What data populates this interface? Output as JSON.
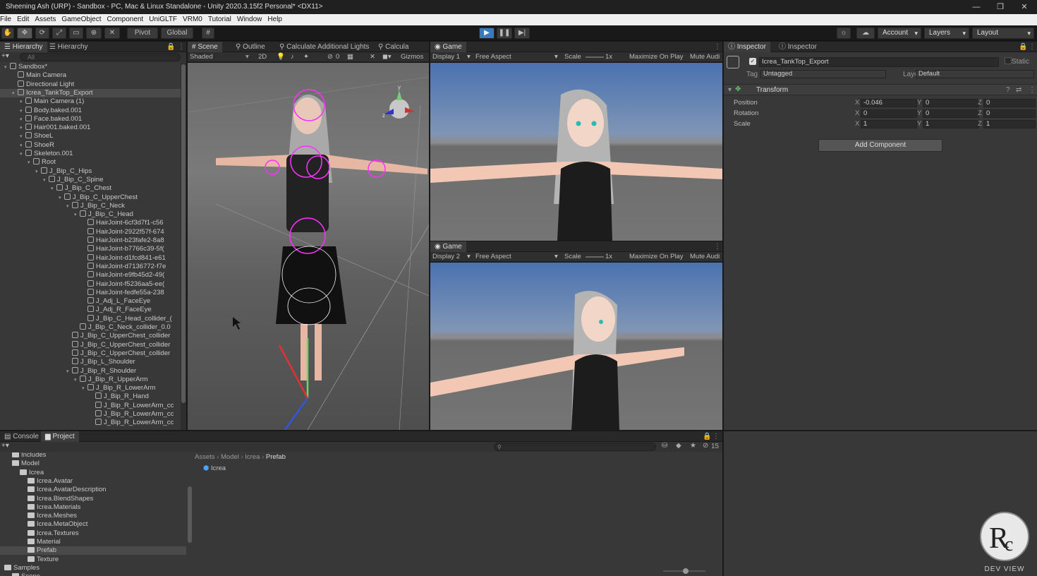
{
  "window": {
    "title": "Sheening Ash (URP) - Sandbox - PC, Mac & Linux Standalone - Unity 2020.3.15f2 Personal* <DX11>",
    "min": "—",
    "max": "❐",
    "close": "✕"
  },
  "menu": [
    "File",
    "Edit",
    "Assets",
    "GameObject",
    "Component",
    "UniGLTF",
    "VRM0",
    "Tutorial",
    "Window",
    "Help"
  ],
  "toolbar": {
    "pivot": "Pivot",
    "global": "Global",
    "account": "Account",
    "layers": "Layers",
    "layout": "Layout"
  },
  "hierarchy": {
    "tabs": [
      "Hierarchy",
      "Hierarchy"
    ],
    "search_placeholder": "All",
    "items": [
      {
        "label": "Sandbox*",
        "depth": 0
      },
      {
        "label": "Main Camera",
        "depth": 1
      },
      {
        "label": "Directional Light",
        "depth": 1
      },
      {
        "label": "Icrea_TankTop_Export",
        "depth": 1
      },
      {
        "label": "Main Camera (1)",
        "depth": 2
      },
      {
        "label": "Body.baked.001",
        "depth": 2
      },
      {
        "label": "Face.baked.001",
        "depth": 2
      },
      {
        "label": "Hair001.baked.001",
        "depth": 2
      },
      {
        "label": "ShoeL",
        "depth": 2
      },
      {
        "label": "ShoeR",
        "depth": 2
      },
      {
        "label": "Skeleton.001",
        "depth": 2
      },
      {
        "label": "Root",
        "depth": 3
      },
      {
        "label": "J_Bip_C_Hips",
        "depth": 4
      },
      {
        "label": "J_Bip_C_Spine",
        "depth": 5
      },
      {
        "label": "J_Bip_C_Chest",
        "depth": 6
      },
      {
        "label": "J_Bip_C_UpperChest",
        "depth": 7
      },
      {
        "label": "J_Bip_C_Neck",
        "depth": 8
      },
      {
        "label": "J_Bip_C_Head",
        "depth": 9
      },
      {
        "label": "HairJoint-6cf3d7f1-c56",
        "depth": 10
      },
      {
        "label": "HairJoint-2922f57f-674",
        "depth": 10
      },
      {
        "label": "HairJoint-b23fafe2-8a8",
        "depth": 10
      },
      {
        "label": "HairJoint-b7766c39-5f(",
        "depth": 10
      },
      {
        "label": "HairJoint-d1fcd841-e61",
        "depth": 10
      },
      {
        "label": "HairJoint-d7136772-f7e",
        "depth": 10
      },
      {
        "label": "HairJoint-e9fb45d2-49(",
        "depth": 10
      },
      {
        "label": "HairJoint-f5236aa5-ee(",
        "depth": 10
      },
      {
        "label": "HairJoint-fedfe55a-238",
        "depth": 10
      },
      {
        "label": "J_Adj_L_FaceEye",
        "depth": 10
      },
      {
        "label": "J_Adj_R_FaceEye",
        "depth": 10
      },
      {
        "label": "J_Bip_C_Head_collider_(",
        "depth": 10
      },
      {
        "label": "J_Bip_C_Neck_collider_0.0",
        "depth": 9
      },
      {
        "label": "J_Bip_C_UpperChest_collider",
        "depth": 8
      },
      {
        "label": "J_Bip_C_UpperChest_collider",
        "depth": 8
      },
      {
        "label": "J_Bip_C_UpperChest_collider",
        "depth": 8
      },
      {
        "label": "J_Bip_L_Shoulder",
        "depth": 8
      },
      {
        "label": "J_Bip_R_Shoulder",
        "depth": 8
      },
      {
        "label": "J_Bip_R_UpperArm",
        "depth": 9
      },
      {
        "label": "J_Bip_R_LowerArm",
        "depth": 10
      },
      {
        "label": "J_Bip_R_Hand",
        "depth": 11
      },
      {
        "label": "J_Bip_R_LowerArm_cc",
        "depth": 11
      },
      {
        "label": "J_Bip_R_LowerArm_cc",
        "depth": 11
      },
      {
        "label": "J_Bip_R_LowerArm_cc",
        "depth": 11
      }
    ]
  },
  "scene": {
    "tabs": [
      "Scene",
      "Outline",
      "Calculate Additional Lights",
      "Calcula"
    ],
    "shading": "Shaded",
    "mode2d": "2D",
    "gizmos": "Gizmos",
    "layers_count": "0"
  },
  "game1": {
    "tab": "Game",
    "display": "Display 1",
    "aspect": "Free Aspect",
    "scale_label": "Scale",
    "scale_value": "1x",
    "maximize": "Maximize On Play",
    "mute": "Mute Audi"
  },
  "game2": {
    "tab": "Game",
    "display": "Display 2",
    "aspect": "Free Aspect",
    "scale_label": "Scale",
    "scale_value": "1x",
    "maximize": "Maximize On Play",
    "mute": "Mute Audi"
  },
  "inspector": {
    "tabs": [
      "Inspector",
      "Inspector"
    ],
    "object_name": "Icrea_TankTop_Export",
    "static": "Static",
    "tag_label": "Tag",
    "tag_value": "Untagged",
    "layer_label": "Layer",
    "layer_value": "Default",
    "transform": "Transform",
    "position": {
      "label": "Position",
      "x": "-0.046",
      "y": "0",
      "z": "0"
    },
    "rotation": {
      "label": "Rotation",
      "x": "0",
      "y": "0",
      "z": "0"
    },
    "scale": {
      "label": "Scale",
      "x": "1",
      "y": "1",
      "z": "1"
    },
    "add_component": "Add Component"
  },
  "bottom": {
    "tabs": [
      "Console",
      "Project"
    ],
    "search_count": "15"
  },
  "project": {
    "tree": [
      {
        "label": "Includes",
        "depth": 1
      },
      {
        "label": "Model",
        "depth": 1
      },
      {
        "label": "Icrea",
        "depth": 2
      },
      {
        "label": "Icrea.Avatar",
        "depth": 3
      },
      {
        "label": "Icrea.AvatarDescription",
        "depth": 3
      },
      {
        "label": "Icrea.BlendShapes",
        "depth": 3
      },
      {
        "label": "Icrea.Materials",
        "depth": 3
      },
      {
        "label": "Icrea.Meshes",
        "depth": 3
      },
      {
        "label": "Icrea.MetaObject",
        "depth": 3
      },
      {
        "label": "Icrea.Textures",
        "depth": 3
      },
      {
        "label": "Material",
        "depth": 3
      },
      {
        "label": "Prefab",
        "depth": 3
      },
      {
        "label": "Texture",
        "depth": 3
      },
      {
        "label": "Samples",
        "depth": 0
      },
      {
        "label": "Scene",
        "depth": 1
      }
    ],
    "breadcrumb": [
      "Assets",
      "Model",
      "Icrea",
      "Prefab"
    ],
    "assets": [
      "Icrea"
    ]
  },
  "watermark": "DEV VIEW"
}
